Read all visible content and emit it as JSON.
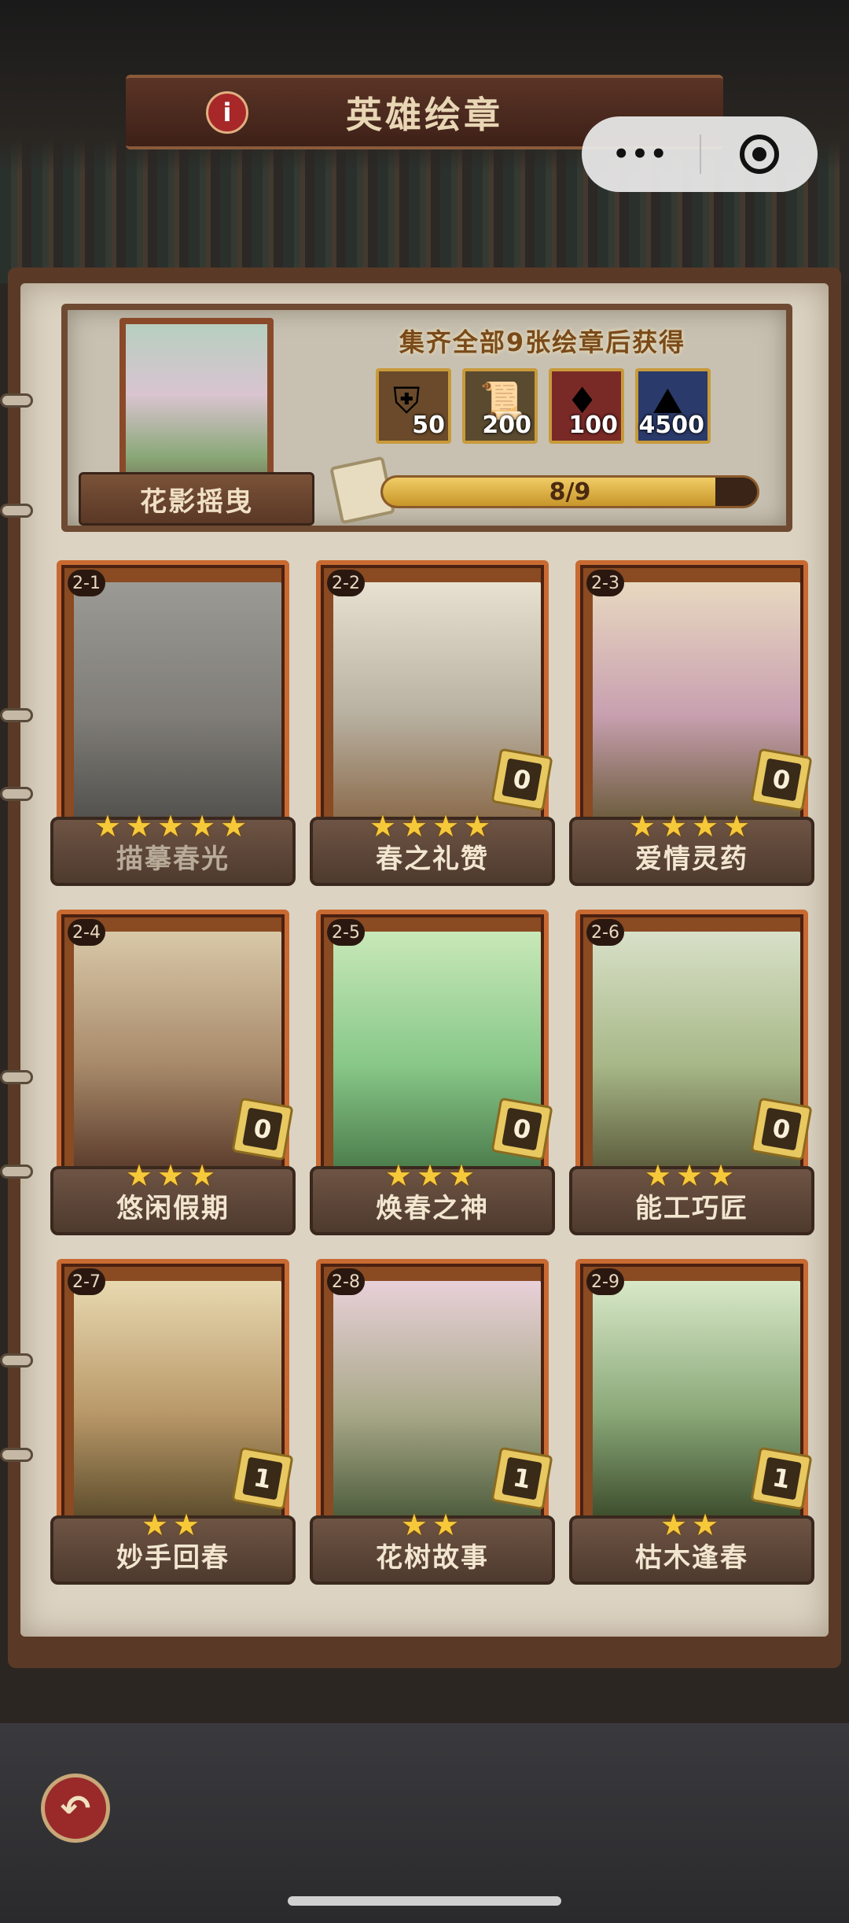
{
  "header": {
    "title": "英雄绘章",
    "info_icon": "i",
    "capsule_more": "•••"
  },
  "album": {
    "name": "花影摇曳",
    "reward_title": "集齐全部9张绘章后获得",
    "rewards": [
      {
        "icon": "armor-chest-icon",
        "glyph": "⛨",
        "amount": "50",
        "bg": "#6a4a2a"
      },
      {
        "icon": "scroll-icon",
        "glyph": "📜",
        "amount": "200",
        "bg": "#5a4a30"
      },
      {
        "icon": "red-gem-icon",
        "glyph": "♦",
        "amount": "100",
        "bg": "#7a2a26"
      },
      {
        "icon": "ore-pile-icon",
        "glyph": "⛰",
        "amount": "4500",
        "bg": "#2a3a6a"
      }
    ],
    "progress_text": "8/9",
    "progress_fraction": 0.889
  },
  "cards": [
    {
      "num": "2-1",
      "name": "描摹春光",
      "stars": "★★★★★",
      "count": "",
      "locked": true,
      "art": [
        "#c8c0a8",
        "#a89c80",
        "#6a6450"
      ]
    },
    {
      "num": "2-2",
      "name": "春之礼赞",
      "stars": "★★★★",
      "count": "0",
      "locked": false,
      "art": [
        "#e8e0d0",
        "#b8b0a0",
        "#8a6a4a"
      ]
    },
    {
      "num": "2-3",
      "name": "爱情灵药",
      "stars": "★★★★",
      "count": "0",
      "locked": false,
      "art": [
        "#e8d8c0",
        "#c8a0b0",
        "#6a5a3a"
      ]
    },
    {
      "num": "2-4",
      "name": "悠闲假期",
      "stars": "★★★",
      "count": "0",
      "locked": false,
      "art": [
        "#d8c8a8",
        "#a88a6a",
        "#5a3a2a"
      ]
    },
    {
      "num": "2-5",
      "name": "焕春之神",
      "stars": "★★★",
      "count": "0",
      "locked": false,
      "art": [
        "#c8e8b8",
        "#88c888",
        "#4a7a4a"
      ]
    },
    {
      "num": "2-6",
      "name": "能工巧匠",
      "stars": "★★★",
      "count": "0",
      "locked": false,
      "art": [
        "#d8e0c8",
        "#a8b888",
        "#5a5a3a"
      ]
    },
    {
      "num": "2-7",
      "name": "妙手回春",
      "stars": "★★",
      "count": "1",
      "locked": false,
      "art": [
        "#e8d8b0",
        "#b89868",
        "#5a4a2a"
      ]
    },
    {
      "num": "2-8",
      "name": "花树故事",
      "stars": "★★",
      "count": "1",
      "locked": false,
      "art": [
        "#e8d0d8",
        "#a8a888",
        "#4a5a3a"
      ]
    },
    {
      "num": "2-9",
      "name": "枯木逢春",
      "stars": "★★",
      "count": "1",
      "locked": false,
      "art": [
        "#d8e8c8",
        "#8aa878",
        "#3a4a2a"
      ]
    }
  ],
  "footer": {
    "back_glyph": "↶"
  }
}
